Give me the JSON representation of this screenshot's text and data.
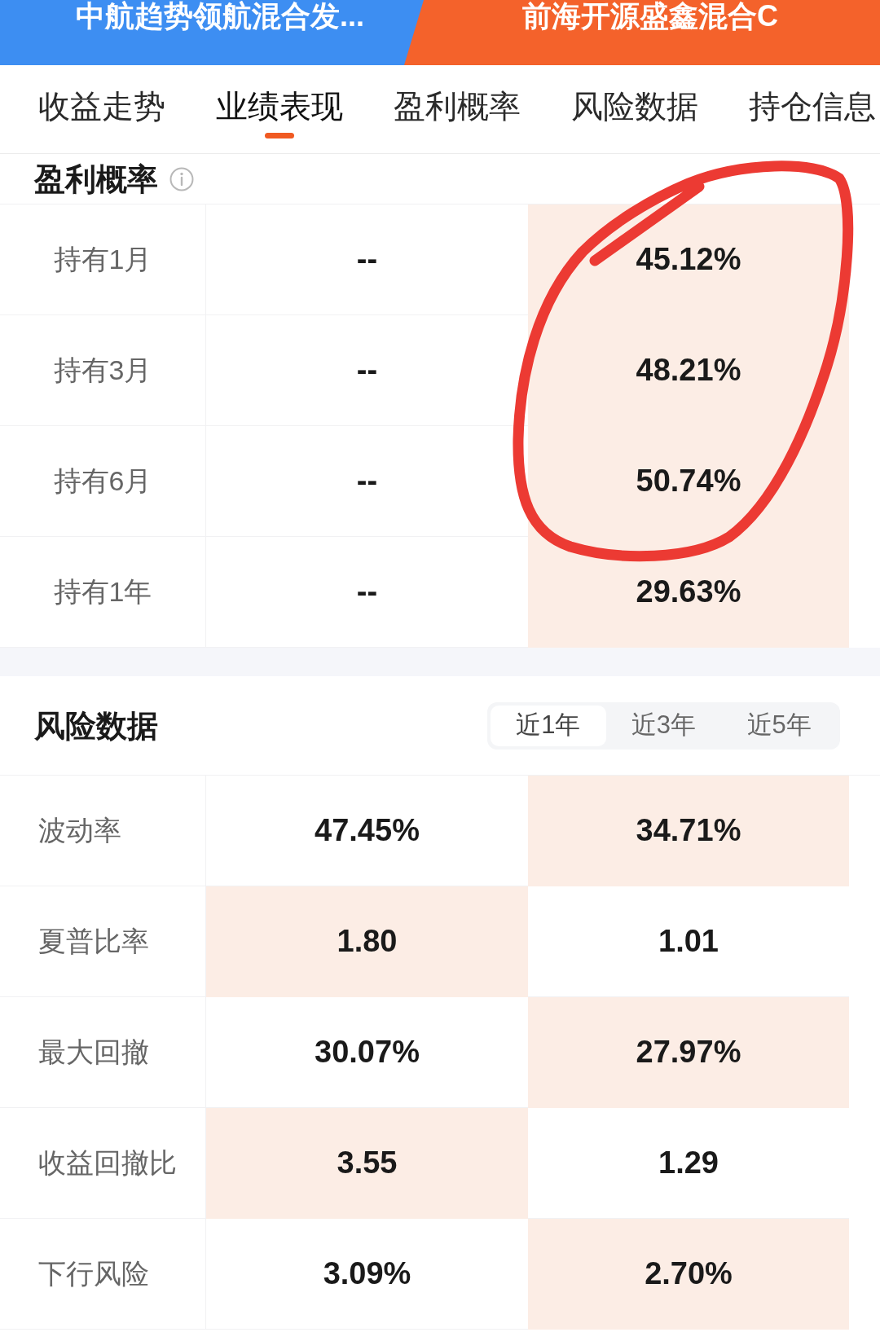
{
  "fund_banners": [
    {
      "name": "中航趋势领航混合发...",
      "color": "#3d8ef2"
    },
    {
      "name": "前海开源盛鑫混合C",
      "color": "#f4622b"
    }
  ],
  "tabs": [
    {
      "label": "收益走势",
      "selected": false
    },
    {
      "label": "业绩表现",
      "selected": true
    },
    {
      "label": "盈利概率",
      "selected": false
    },
    {
      "label": "风险数据",
      "selected": false
    },
    {
      "label": "持仓信息",
      "selected": false
    }
  ],
  "profit_probability": {
    "title": "盈利概率",
    "rows": [
      {
        "label": "持有1月",
        "values": [
          {
            "text": "--",
            "highlighted": false
          },
          {
            "text": "45.12%",
            "highlighted": true
          }
        ]
      },
      {
        "label": "持有3月",
        "values": [
          {
            "text": "--",
            "highlighted": false
          },
          {
            "text": "48.21%",
            "highlighted": true
          }
        ]
      },
      {
        "label": "持有6月",
        "values": [
          {
            "text": "--",
            "highlighted": false
          },
          {
            "text": "50.74%",
            "highlighted": true
          }
        ]
      },
      {
        "label": "持有1年",
        "values": [
          {
            "text": "--",
            "highlighted": false
          },
          {
            "text": "29.63%",
            "highlighted": true
          }
        ]
      }
    ]
  },
  "markup": {
    "kind": "loop"
  },
  "risk_data": {
    "title": "风险数据",
    "periods": [
      {
        "label": "近1年",
        "selected": true
      },
      {
        "label": "近3年",
        "selected": false
      },
      {
        "label": "近5年",
        "selected": false
      }
    ],
    "rows": [
      {
        "label": "波动率",
        "values": [
          {
            "text": "47.45%",
            "highlighted": false
          },
          {
            "text": "34.71%",
            "highlighted": true
          }
        ]
      },
      {
        "label": "夏普比率",
        "values": [
          {
            "text": "1.80",
            "highlighted": true
          },
          {
            "text": "1.01",
            "highlighted": false
          }
        ]
      },
      {
        "label": "最大回撤",
        "values": [
          {
            "text": "30.07%",
            "highlighted": false
          },
          {
            "text": "27.97%",
            "highlighted": true
          }
        ]
      },
      {
        "label": "收益回撤比",
        "values": [
          {
            "text": "3.55",
            "highlighted": true
          },
          {
            "text": "1.29",
            "highlighted": false
          }
        ]
      },
      {
        "label": "下行风险",
        "values": [
          {
            "text": "3.09%",
            "highlighted": false
          },
          {
            "text": "2.70%",
            "highlighted": true
          }
        ]
      }
    ]
  }
}
